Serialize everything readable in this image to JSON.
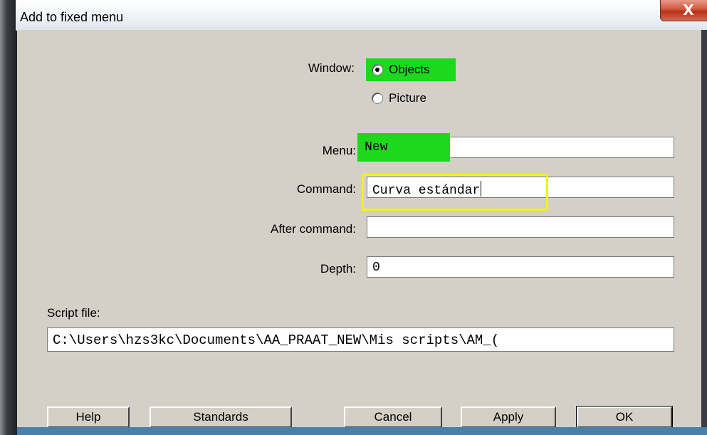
{
  "window": {
    "title": "Add to fixed menu",
    "close_label": "X"
  },
  "form": {
    "window_label": "Window:",
    "window_options": [
      "Objects",
      "Picture"
    ],
    "window_selected": "Objects",
    "menu_label": "Menu:",
    "menu_value": "New",
    "command_label": "Command:",
    "command_value": "Curva estándar",
    "after_command_label": "After command:",
    "after_command_value": "",
    "depth_label": "Depth:",
    "depth_value": "0",
    "script_file_label": "Script file:",
    "script_file_value": "C:\\Users\\hzs3kc\\Documents\\AA_PRAAT_NEW\\Mis scripts\\AM_("
  },
  "buttons": {
    "help": "Help",
    "standards": "Standards",
    "cancel": "Cancel",
    "apply": "Apply",
    "ok": "OK"
  },
  "annotations": {
    "green_highlight": "#1dd81d",
    "yellow_highlight": "#f2f21a"
  }
}
